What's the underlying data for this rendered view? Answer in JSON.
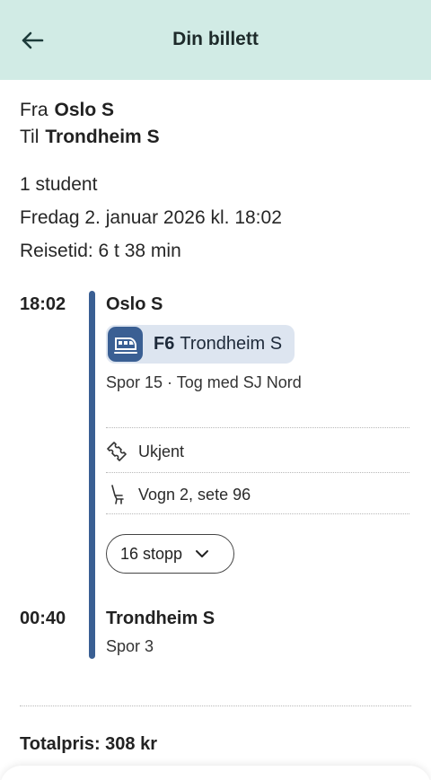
{
  "header": {
    "title": "Din billett",
    "back_icon": "arrow-left-icon"
  },
  "route": {
    "from_label": "Fra",
    "from_station": "Oslo S",
    "to_label": "Til",
    "to_station": "Trondheim S"
  },
  "trip_info": {
    "passengers": "1 student",
    "date": "Fredag 2. januar 2026 kl. 18:02",
    "duration": "Reisetid: 6 t 38 min"
  },
  "journey": {
    "departure": {
      "time": "18:02",
      "station": "Oslo S"
    },
    "line": {
      "code": "F6",
      "destination": "Trondheim S",
      "icon": "train-icon"
    },
    "platform_operator": "Spor 15 · Tog med SJ Nord",
    "ticket_type": {
      "icon": "ticket-icon",
      "label": "Ukjent"
    },
    "seat": {
      "icon": "seat-icon",
      "label": "Vogn 2, sete 96"
    },
    "stops_button": {
      "label": "16 stopp",
      "icon": "chevron-down-icon"
    },
    "arrival": {
      "time": "00:40",
      "station": "Trondheim S",
      "platform": "Spor 3"
    }
  },
  "total": "Totalpris: 308 kr",
  "colors": {
    "header_bg": "#d1ebe5",
    "timeline": "#3a5f93",
    "chip_bg": "#dde5f0"
  }
}
